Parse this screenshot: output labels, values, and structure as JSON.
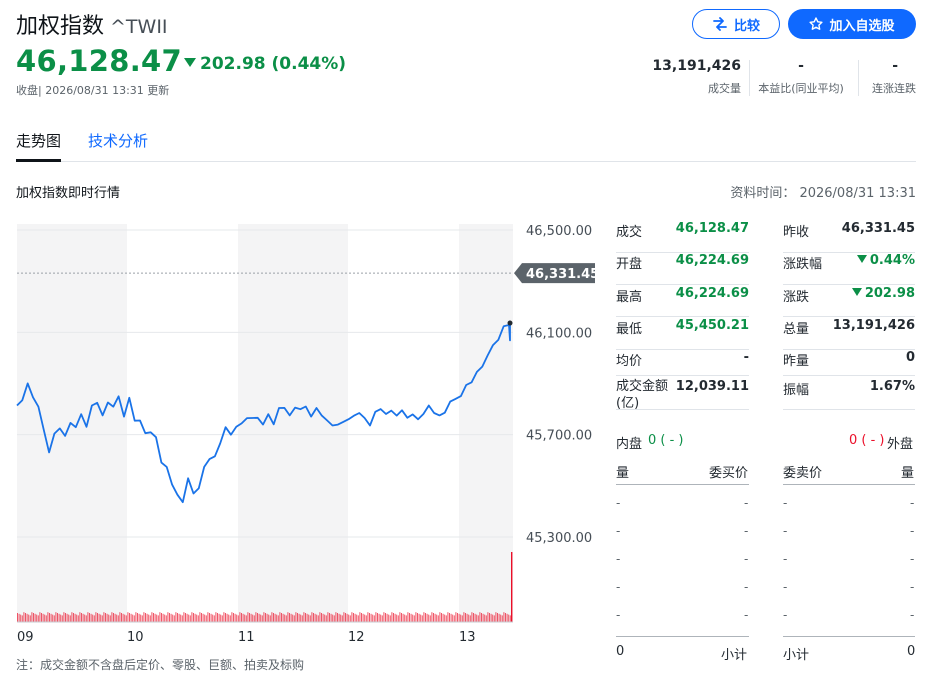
{
  "header": {
    "name": "加权指数",
    "symbol": "^TWII",
    "price": "46,128.47",
    "change": "202.98",
    "change_pct": "(0.44%)",
    "updated": "收盘| 2026/08/31 13:31 更新",
    "compare_label": "比较",
    "watchlist_label": "加入自选股"
  },
  "stats": [
    {
      "value": "13,191,426",
      "label": "成交量"
    },
    {
      "value": "-",
      "label": "本益比(同业平均)"
    },
    {
      "value": "-",
      "label": "连涨连跌"
    }
  ],
  "tabs": [
    {
      "label": "走势图",
      "active": true
    },
    {
      "label": "技术分析",
      "active": false
    }
  ],
  "section": {
    "title": "加权指数即时行情",
    "data_time": "资料时间： 2026/08/31 13:31"
  },
  "chart_data": {
    "type": "line",
    "x_ticks": [
      "09",
      "10",
      "11",
      "12",
      "13"
    ],
    "y_ticks": [
      "46,500.00",
      "46,100.00",
      "45,700.00",
      "45,300.00"
    ],
    "ylim": [
      45150,
      46500
    ],
    "prev_close": 46331.45,
    "prev_close_label": "46,331.45",
    "last": 46128.47,
    "series": [
      {
        "values": [
          45800,
          45830,
          45905,
          45860,
          45800,
          45720,
          45640,
          45690,
          45720,
          45700,
          45760,
          45720,
          45780,
          45740,
          45800,
          45820,
          45780,
          45840,
          45800,
          45850,
          45780,
          45830,
          45750,
          45760,
          45720,
          45700,
          45690,
          45600,
          45560,
          45500,
          45470,
          45450,
          45520,
          45470,
          45500,
          45560,
          45600,
          45620,
          45680,
          45720,
          45700,
          45740,
          45730,
          45760,
          45770,
          45780,
          45730,
          45780,
          45750,
          45790,
          45800,
          45780,
          45820,
          45790,
          45810,
          45780,
          45790,
          45770,
          45760,
          45750,
          45730,
          45750,
          45770,
          45760,
          45780,
          45770,
          45750,
          45780,
          45800,
          45790,
          45780,
          45770,
          45800,
          45780,
          45770,
          45760,
          45790,
          45800,
          45780,
          45780,
          45800,
          45820,
          45840,
          45860,
          45880,
          45900,
          45950,
          45980,
          46000,
          46050,
          46080,
          46110,
          46128.47
        ]
      }
    ],
    "volume": "dense-red-bars"
  },
  "quote": {
    "left": [
      {
        "label": "成交",
        "value": "46,128.47",
        "color": "green"
      },
      {
        "label": "开盘",
        "value": "46,224.69",
        "color": "green"
      },
      {
        "label": "最高",
        "value": "46,224.69",
        "color": "green"
      },
      {
        "label": "最低",
        "value": "45,450.21",
        "color": "green"
      },
      {
        "label": "均价",
        "value": "-",
        "color": "dark"
      },
      {
        "label": "成交金额",
        "label2": "(亿)",
        "value": "12,039.11",
        "color": "dark"
      }
    ],
    "right": [
      {
        "label": "昨收",
        "value": "46,331.45",
        "color": "dark"
      },
      {
        "label": "涨跌幅",
        "value": "0.44%",
        "color": "green",
        "arrow": true
      },
      {
        "label": "涨跌",
        "value": "202.98",
        "color": "green",
        "arrow": true
      },
      {
        "label": "总量",
        "value": "13,191,426",
        "color": "dark"
      },
      {
        "label": "昨量",
        "value": "0",
        "color": "dark"
      },
      {
        "label": "振幅",
        "value": "1.67%",
        "color": "dark"
      }
    ]
  },
  "orderbook": {
    "inner_label": "内盘",
    "inner_value": "0",
    "inner_pct": "( - )",
    "outer_label": "外盘",
    "outer_value": "0",
    "outer_pct": "( - )",
    "bid_headers": [
      "量",
      "委买价"
    ],
    "ask_headers": [
      "委卖价",
      "量"
    ],
    "dash": "-",
    "subtotal_label": "小计",
    "bid_subtotal": "0",
    "ask_subtotal": "0"
  },
  "note": "注：成交金额不含盘后定价、零股、巨额、拍卖及标购"
}
